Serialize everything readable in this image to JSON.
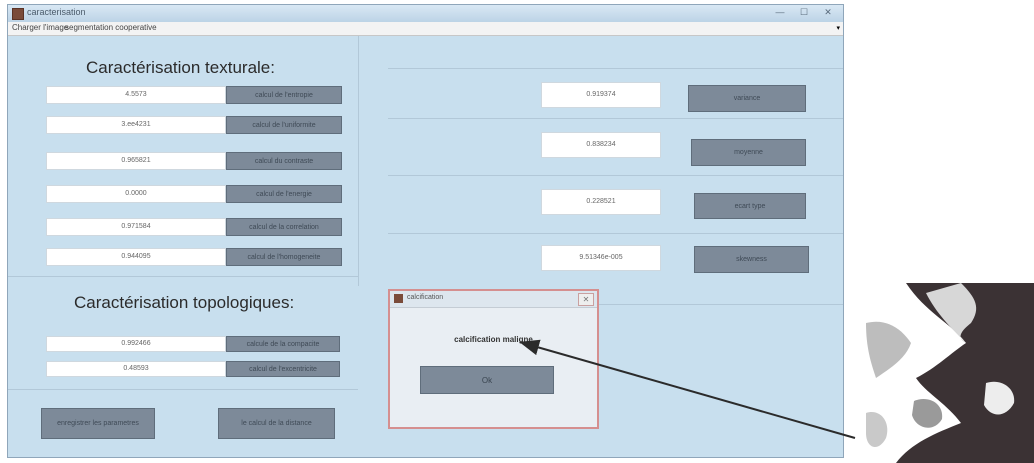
{
  "window": {
    "title": "caracterisation",
    "controls": [
      "—",
      "☐",
      "✕"
    ]
  },
  "menubar": {
    "items": [
      "Charger l'image",
      "segmentation cooperative"
    ],
    "arrow": "▾"
  },
  "textural": {
    "heading": "Caractérisation texturale:",
    "left_rows": [
      {
        "value": "4.5573",
        "button": "calcul de l'entropie"
      },
      {
        "value": "3.ee4231",
        "button": "calcul de l'uniformite"
      },
      {
        "value": "0.965821",
        "button": "calcul du contraste"
      },
      {
        "value": "0.0000",
        "button": "calcul de l'energie"
      },
      {
        "value": "0.971584",
        "button": "calcul de la correlation"
      },
      {
        "value": "0.944095",
        "button": "calcul de l'homogeneite"
      }
    ],
    "right_rows": [
      {
        "value": "0.919374",
        "button": "variance"
      },
      {
        "value": "0.838234",
        "button": "moyenne"
      },
      {
        "value": "0.228521",
        "button": "ecart type"
      },
      {
        "value": "9.51346e-005",
        "button": "skewness"
      }
    ]
  },
  "topological": {
    "heading": "Caractérisation topologiques:",
    "rows": [
      {
        "value": "0.992466",
        "button": "calcule de la compacite"
      },
      {
        "value": "0.48593",
        "button": "calcul de l'excentricite"
      }
    ]
  },
  "bottom_buttons": {
    "save": "enregistrer les parametres",
    "distance": "le calcul de la distance"
  },
  "dialog": {
    "title": "calcification",
    "message": "calcification maligne",
    "ok": "Ok",
    "close": "✕"
  },
  "colors": {
    "window_bg": "#c8dfee",
    "button_bg": "#7d8a99",
    "dialog_border": "#d58f8f",
    "arrow": "#2b2b2b"
  }
}
